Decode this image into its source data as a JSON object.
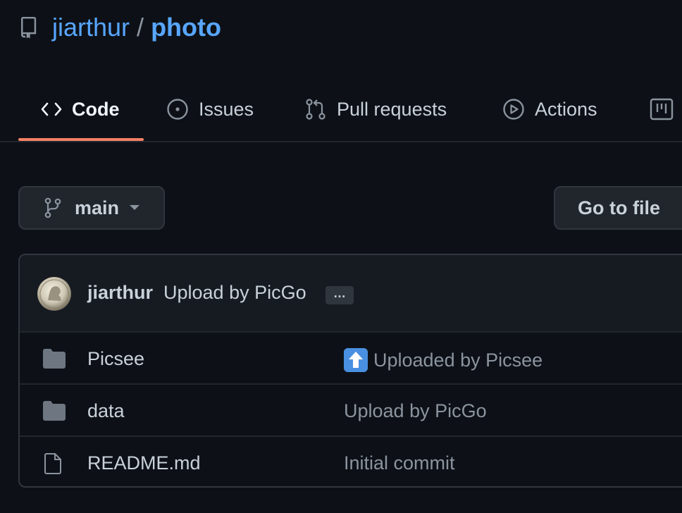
{
  "repo": {
    "owner": "jiarthur",
    "separator": "/",
    "name": "photo"
  },
  "tabs": [
    {
      "label": "Code",
      "icon": "code-icon",
      "selected": true
    },
    {
      "label": "Issues",
      "icon": "issue-circle-icon",
      "selected": false
    },
    {
      "label": "Pull requests",
      "icon": "pull-request-icon",
      "selected": false
    },
    {
      "label": "Actions",
      "icon": "play-circle-icon",
      "selected": false
    },
    {
      "label": "",
      "icon": "project-board-icon",
      "selected": false
    }
  ],
  "branch": {
    "label": "main",
    "icon": "git-branch-icon"
  },
  "go_to_file": {
    "label": "Go to file"
  },
  "commit": {
    "author": "jiarthur",
    "message": "Upload by PicGo",
    "ellipsis": "…"
  },
  "files": [
    {
      "name": "Picsee",
      "type": "folder",
      "message": "Uploaded by Picsee",
      "emoji": "up-arrow-emoji"
    },
    {
      "name": "data",
      "type": "folder",
      "message": "Upload by PicGo"
    },
    {
      "name": "README.md",
      "type": "file",
      "message": "Initial commit"
    }
  ],
  "colors": {
    "background": "#0d1117",
    "link": "#58a6ff",
    "tab_underline": "#f78166",
    "text": "#c9d1d9",
    "muted": "#8b949e"
  }
}
